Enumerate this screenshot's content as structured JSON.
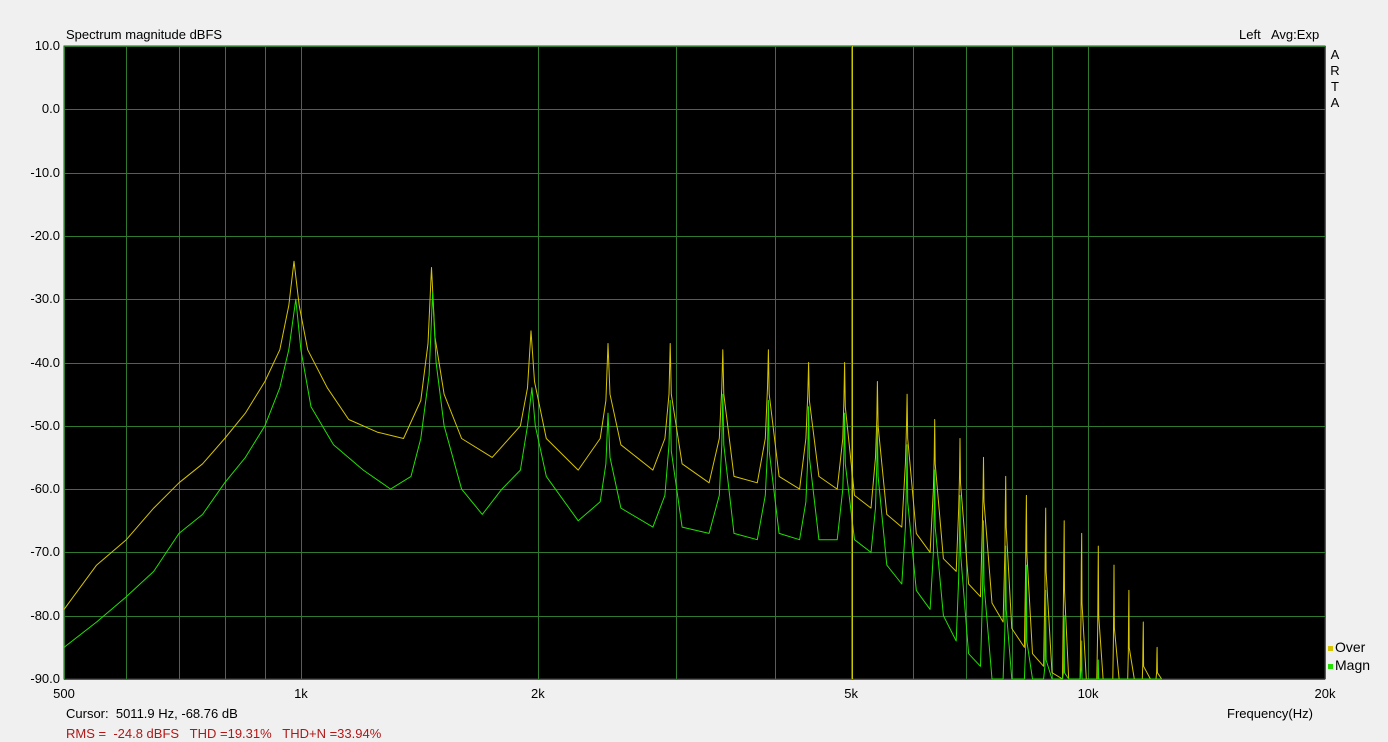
{
  "header": {
    "title": "Spectrum magnitude dBFS",
    "channel": "Left",
    "averaging": "Avg:Exp"
  },
  "brand_letters": [
    "A",
    "R",
    "T",
    "A"
  ],
  "cursor_readout": "Cursor:  5011.9 Hz, -68.76 dB",
  "status_line": "RMS =  -24.8 dBFS   THD =19.31%   THD+N =33.94%",
  "x_axis_label": "Frequency(Hz)",
  "legend": [
    {
      "label": "Over",
      "color": "#d6c400"
    },
    {
      "label": "Magn",
      "color": "#22e000"
    }
  ],
  "chart_data": {
    "type": "line",
    "title": "Spectrum magnitude dBFS",
    "xlabel": "Frequency(Hz)",
    "ylabel": "",
    "xscale": "log",
    "xlim": [
      500,
      20000
    ],
    "ylim": [
      -90,
      10
    ],
    "grid": true,
    "legend_position": "bottom-right",
    "x_ticks": [
      {
        "value": 500,
        "label": "500"
      },
      {
        "value": 1000,
        "label": "1k"
      },
      {
        "value": 2000,
        "label": "2k"
      },
      {
        "value": 5000,
        "label": "5k"
      },
      {
        "value": 10000,
        "label": "10k"
      },
      {
        "value": 20000,
        "label": "20k"
      }
    ],
    "x_minor_gridlines": [
      600,
      700,
      800,
      900,
      3000,
      4000,
      6000,
      7000,
      8000,
      9000
    ],
    "y_ticks": [
      10,
      0,
      -10,
      -20,
      -30,
      -40,
      -50,
      -60,
      -70,
      -80,
      -90
    ],
    "y_tick_labels": [
      "10.0",
      "0.0",
      "-10.0",
      "-20.0",
      "-30.0",
      "-40.0",
      "-50.0",
      "-60.0",
      "-70.0",
      "-80.0",
      "-90.0"
    ],
    "cursor": {
      "frequency_hz": 5011.9,
      "level_db": -68.76,
      "color": "#c8c800"
    },
    "fundamental_hz": 980,
    "series": [
      {
        "name": "Over",
        "color": "#d6c400",
        "points": [
          [
            500,
            -79
          ],
          [
            550,
            -72
          ],
          [
            600,
            -68
          ],
          [
            650,
            -63
          ],
          [
            700,
            -59
          ],
          [
            750,
            -56
          ],
          [
            800,
            -52
          ],
          [
            850,
            -48
          ],
          [
            900,
            -43
          ],
          [
            940,
            -38
          ],
          [
            965,
            -31
          ],
          [
            980,
            -24
          ],
          [
            995,
            -31
          ],
          [
            1020,
            -38
          ],
          [
            1080,
            -44
          ],
          [
            1150,
            -49
          ],
          [
            1250,
            -51
          ],
          [
            1350,
            -52
          ],
          [
            1420,
            -46
          ],
          [
            1450,
            -37
          ],
          [
            1465,
            -25
          ],
          [
            1480,
            -36
          ],
          [
            1520,
            -45
          ],
          [
            1600,
            -52
          ],
          [
            1750,
            -55
          ],
          [
            1900,
            -50
          ],
          [
            1940,
            -44
          ],
          [
            1960,
            -35
          ],
          [
            1980,
            -43
          ],
          [
            2050,
            -52
          ],
          [
            2250,
            -57
          ],
          [
            2400,
            -52
          ],
          [
            2440,
            -46
          ],
          [
            2455,
            -37
          ],
          [
            2470,
            -45
          ],
          [
            2550,
            -53
          ],
          [
            2800,
            -57
          ],
          [
            2900,
            -52
          ],
          [
            2935,
            -45
          ],
          [
            2945,
            -37
          ],
          [
            2955,
            -45
          ],
          [
            3050,
            -56
          ],
          [
            3300,
            -59
          ],
          [
            3400,
            -52
          ],
          [
            3425,
            -44
          ],
          [
            3435,
            -38
          ],
          [
            3445,
            -45
          ],
          [
            3550,
            -58
          ],
          [
            3800,
            -59
          ],
          [
            3890,
            -52
          ],
          [
            3915,
            -44
          ],
          [
            3925,
            -38
          ],
          [
            3935,
            -45
          ],
          [
            4050,
            -58
          ],
          [
            4300,
            -60
          ],
          [
            4380,
            -52
          ],
          [
            4405,
            -45
          ],
          [
            4415,
            -40
          ],
          [
            4425,
            -46
          ],
          [
            4550,
            -58
          ],
          [
            4800,
            -60
          ],
          [
            4880,
            -52
          ],
          [
            4895,
            -46
          ],
          [
            4905,
            -40
          ],
          [
            4915,
            -47
          ],
          [
            5050,
            -61
          ],
          [
            5300,
            -63
          ],
          [
            5370,
            -55
          ],
          [
            5390,
            -49
          ],
          [
            5400,
            -43
          ],
          [
            5410,
            -50
          ],
          [
            5550,
            -64
          ],
          [
            5800,
            -66
          ],
          [
            5860,
            -56
          ],
          [
            5880,
            -50
          ],
          [
            5890,
            -45
          ],
          [
            5900,
            -52
          ],
          [
            6050,
            -67
          ],
          [
            6300,
            -70
          ],
          [
            6360,
            -60
          ],
          [
            6375,
            -55
          ],
          [
            6385,
            -49
          ],
          [
            6395,
            -56
          ],
          [
            6550,
            -71
          ],
          [
            6800,
            -73
          ],
          [
            6850,
            -63
          ],
          [
            6865,
            -58
          ],
          [
            6875,
            -52
          ],
          [
            6885,
            -59
          ],
          [
            7050,
            -75
          ],
          [
            7300,
            -77
          ],
          [
            7340,
            -66
          ],
          [
            7355,
            -61
          ],
          [
            7365,
            -55
          ],
          [
            7375,
            -62
          ],
          [
            7550,
            -78
          ],
          [
            7800,
            -81
          ],
          [
            7840,
            -70
          ],
          [
            7850,
            -63
          ],
          [
            7860,
            -58
          ],
          [
            7870,
            -66
          ],
          [
            8000,
            -82
          ],
          [
            8300,
            -85
          ],
          [
            8330,
            -73
          ],
          [
            8340,
            -66
          ],
          [
            8350,
            -61
          ],
          [
            8360,
            -70
          ],
          [
            8500,
            -86
          ],
          [
            8780,
            -88
          ],
          [
            8815,
            -76
          ],
          [
            8825,
            -68
          ],
          [
            8835,
            -63
          ],
          [
            8845,
            -73
          ],
          [
            9000,
            -89
          ],
          [
            9280,
            -90
          ],
          [
            9305,
            -78
          ],
          [
            9315,
            -71
          ],
          [
            9325,
            -65
          ],
          [
            9335,
            -76
          ],
          [
            9450,
            -90
          ],
          [
            9770,
            -90
          ],
          [
            9795,
            -80
          ],
          [
            9805,
            -72
          ],
          [
            9815,
            -67
          ],
          [
            9825,
            -78
          ],
          [
            9950,
            -90
          ],
          [
            10260,
            -90
          ],
          [
            10285,
            -82
          ],
          [
            10295,
            -75
          ],
          [
            10305,
            -69
          ],
          [
            10315,
            -80
          ],
          [
            10450,
            -90
          ],
          [
            10750,
            -90
          ],
          [
            10770,
            -84
          ],
          [
            10780,
            -78
          ],
          [
            10790,
            -72
          ],
          [
            10800,
            -82
          ],
          [
            10950,
            -90
          ],
          [
            11230,
            -90
          ],
          [
            11250,
            -86
          ],
          [
            11260,
            -80
          ],
          [
            11270,
            -76
          ],
          [
            11280,
            -85
          ],
          [
            11450,
            -90
          ],
          [
            11720,
            -90
          ],
          [
            11735,
            -88
          ],
          [
            11745,
            -84
          ],
          [
            11755,
            -81
          ],
          [
            11765,
            -88
          ],
          [
            12000,
            -90
          ],
          [
            12200,
            -90
          ],
          [
            12220,
            -89
          ],
          [
            12230,
            -86
          ],
          [
            12240,
            -85
          ],
          [
            12250,
            -89
          ],
          [
            12400,
            -90
          ]
        ]
      },
      {
        "name": "Magn",
        "color": "#22e000",
        "points": [
          [
            500,
            -85
          ],
          [
            550,
            -81
          ],
          [
            600,
            -77
          ],
          [
            650,
            -73
          ],
          [
            700,
            -67
          ],
          [
            750,
            -64
          ],
          [
            800,
            -59
          ],
          [
            850,
            -55
          ],
          [
            900,
            -50
          ],
          [
            940,
            -44
          ],
          [
            965,
            -38
          ],
          [
            985,
            -30
          ],
          [
            1000,
            -38
          ],
          [
            1030,
            -47
          ],
          [
            1100,
            -53
          ],
          [
            1200,
            -57
          ],
          [
            1300,
            -60
          ],
          [
            1380,
            -58
          ],
          [
            1420,
            -52
          ],
          [
            1455,
            -42
          ],
          [
            1470,
            -29
          ],
          [
            1485,
            -40
          ],
          [
            1520,
            -50
          ],
          [
            1600,
            -60
          ],
          [
            1700,
            -64
          ],
          [
            1800,
            -60
          ],
          [
            1900,
            -57
          ],
          [
            1940,
            -50
          ],
          [
            1965,
            -44
          ],
          [
            1985,
            -50
          ],
          [
            2050,
            -58
          ],
          [
            2250,
            -65
          ],
          [
            2400,
            -62
          ],
          [
            2440,
            -56
          ],
          [
            2455,
            -48
          ],
          [
            2470,
            -55
          ],
          [
            2550,
            -63
          ],
          [
            2800,
            -66
          ],
          [
            2900,
            -61
          ],
          [
            2935,
            -53
          ],
          [
            2945,
            -46
          ],
          [
            2955,
            -54
          ],
          [
            3050,
            -66
          ],
          [
            3300,
            -67
          ],
          [
            3400,
            -61
          ],
          [
            3425,
            -53
          ],
          [
            3435,
            -45
          ],
          [
            3445,
            -53
          ],
          [
            3550,
            -67
          ],
          [
            3800,
            -68
          ],
          [
            3890,
            -61
          ],
          [
            3915,
            -54
          ],
          [
            3925,
            -46
          ],
          [
            3935,
            -54
          ],
          [
            4050,
            -67
          ],
          [
            4300,
            -68
          ],
          [
            4380,
            -62
          ],
          [
            4405,
            -55
          ],
          [
            4415,
            -47
          ],
          [
            4425,
            -55
          ],
          [
            4550,
            -68
          ],
          [
            4800,
            -68
          ],
          [
            4880,
            -60
          ],
          [
            4895,
            -54
          ],
          [
            4905,
            -48
          ],
          [
            4915,
            -56
          ],
          [
            5050,
            -68
          ],
          [
            5300,
            -70
          ],
          [
            5370,
            -63
          ],
          [
            5390,
            -56
          ],
          [
            5400,
            -50
          ],
          [
            5410,
            -58
          ],
          [
            5550,
            -72
          ],
          [
            5800,
            -75
          ],
          [
            5860,
            -66
          ],
          [
            5880,
            -59
          ],
          [
            5890,
            -53
          ],
          [
            5900,
            -62
          ],
          [
            6050,
            -76
          ],
          [
            6300,
            -79
          ],
          [
            6360,
            -70
          ],
          [
            6375,
            -63
          ],
          [
            6385,
            -57
          ],
          [
            6395,
            -66
          ],
          [
            6550,
            -80
          ],
          [
            6800,
            -84
          ],
          [
            6850,
            -74
          ],
          [
            6865,
            -67
          ],
          [
            6875,
            -61
          ],
          [
            6885,
            -70
          ],
          [
            7050,
            -86
          ],
          [
            7300,
            -88
          ],
          [
            7340,
            -78
          ],
          [
            7355,
            -71
          ],
          [
            7365,
            -65
          ],
          [
            7375,
            -75
          ],
          [
            7550,
            -90
          ],
          [
            7800,
            -90
          ],
          [
            7840,
            -82
          ],
          [
            7850,
            -75
          ],
          [
            7860,
            -69
          ],
          [
            7870,
            -79
          ],
          [
            8000,
            -90
          ],
          [
            8300,
            -90
          ],
          [
            8330,
            -85
          ],
          [
            8340,
            -78
          ],
          [
            8350,
            -72
          ],
          [
            8360,
            -84
          ],
          [
            8500,
            -90
          ],
          [
            8780,
            -90
          ],
          [
            8815,
            -88
          ],
          [
            8825,
            -82
          ],
          [
            8835,
            -76
          ],
          [
            8845,
            -87
          ],
          [
            9000,
            -90
          ],
          [
            9280,
            -90
          ],
          [
            9305,
            -89
          ],
          [
            9315,
            -85
          ],
          [
            9325,
            -80
          ],
          [
            9335,
            -89
          ],
          [
            9450,
            -90
          ],
          [
            9770,
            -90
          ],
          [
            9805,
            -88
          ],
          [
            9815,
            -84
          ],
          [
            9825,
            -90
          ],
          [
            10260,
            -90
          ],
          [
            10295,
            -90
          ],
          [
            10305,
            -87
          ],
          [
            10315,
            -90
          ],
          [
            10800,
            -90
          ],
          [
            12400,
            -90
          ]
        ]
      }
    ]
  }
}
